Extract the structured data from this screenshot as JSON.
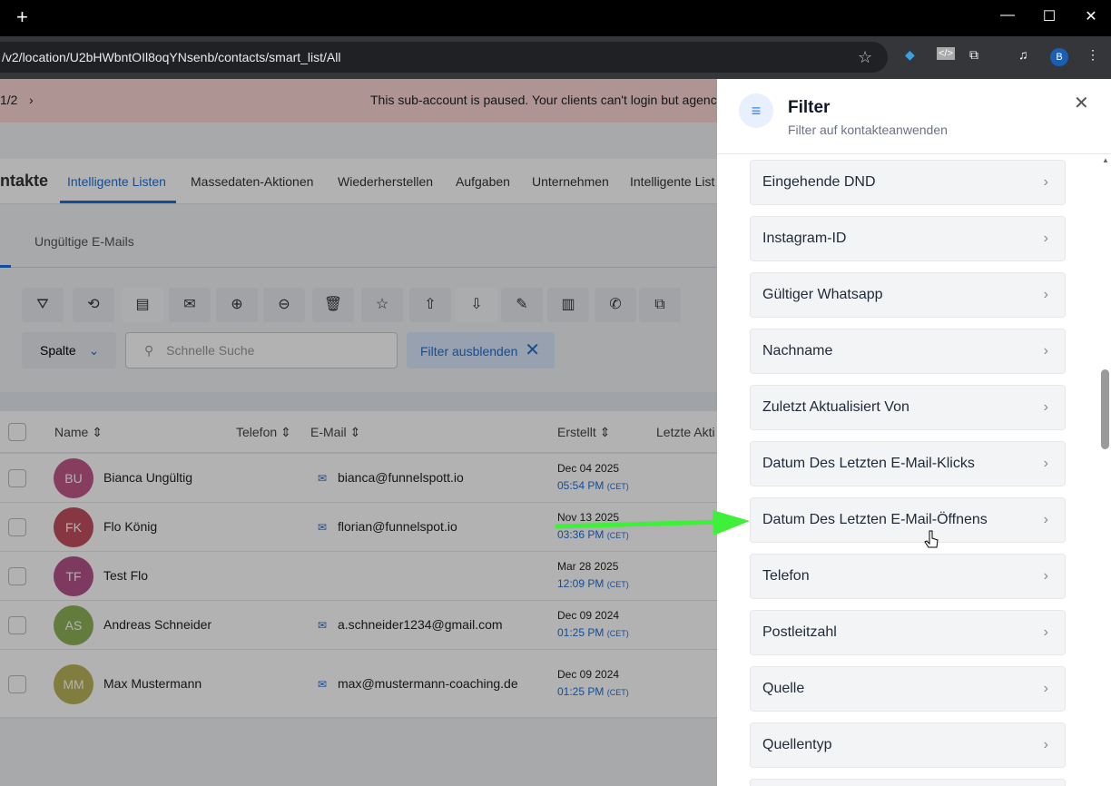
{
  "browser": {
    "url": "/v2/location/U2bHWbntOIl8oqYNsenb/contacts/smart_list/All",
    "profile": "B"
  },
  "banner": {
    "pager": "1/2",
    "text": "This sub-account is paused. Your clients can't login but agenc"
  },
  "tabs": {
    "title": "ntakte",
    "items": [
      "Intelligente Listen",
      "Massedaten-Aktionen",
      "Wiederherstellen",
      "Aufgaben",
      "Unternehmen",
      "Intelligente List"
    ]
  },
  "subtabs": [
    "Ungültige E-Mails"
  ],
  "filters": {
    "column": "Spalte",
    "search_placeholder": "Schnelle Suche",
    "hide_filters": "Filter ausblenden"
  },
  "table": {
    "headers": [
      "Name",
      "Telefon",
      "E-Mail",
      "Erstellt",
      "Letzte Akti"
    ],
    "rows": [
      {
        "initials": "BU",
        "name": "Bianca Ungültig",
        "email": "bianca@funnelspott.io",
        "date": "Dec 04 2025",
        "time": "05:54 PM",
        "tz": "(CET)",
        "color": "#c0588a"
      },
      {
        "initials": "FK",
        "name": "Flo König",
        "email": "florian@funnelspot.io",
        "date": "Nov 13 2025",
        "time": "03:36 PM",
        "tz": "(CET)",
        "color": "#c0505f"
      },
      {
        "initials": "TF",
        "name": "Test Flo",
        "email": "",
        "date": "Mar 28 2025",
        "time": "12:09 PM",
        "tz": "(CET)",
        "color": "#b5528a"
      },
      {
        "initials": "AS",
        "name": "Andreas Schneider",
        "email": "a.schneider1234@gmail.com",
        "date": "Dec 09 2024",
        "time": "01:25 PM",
        "tz": "(CET)",
        "color": "#8fb25a"
      },
      {
        "initials": "MM",
        "name": "Max Mustermann",
        "email": "max@mustermann-coaching.de",
        "date": "Dec 09 2024",
        "time": "01:25 PM",
        "tz": "(CET)",
        "color": "#b8b45a"
      }
    ]
  },
  "panel": {
    "title": "Filter",
    "subtitle": "Filter auf kontakteanwenden",
    "items": [
      "Eingehende DND",
      "Instagram-ID",
      "Gültiger Whatsapp",
      "Nachname",
      "Zuletzt Aktualisiert Von",
      "Datum Des Letzten E-Mail-Klicks",
      "Datum Des Letzten E-Mail-Öffnens",
      "Telefon",
      "Postleitzahl",
      "Quelle",
      "Quellentyp"
    ]
  }
}
